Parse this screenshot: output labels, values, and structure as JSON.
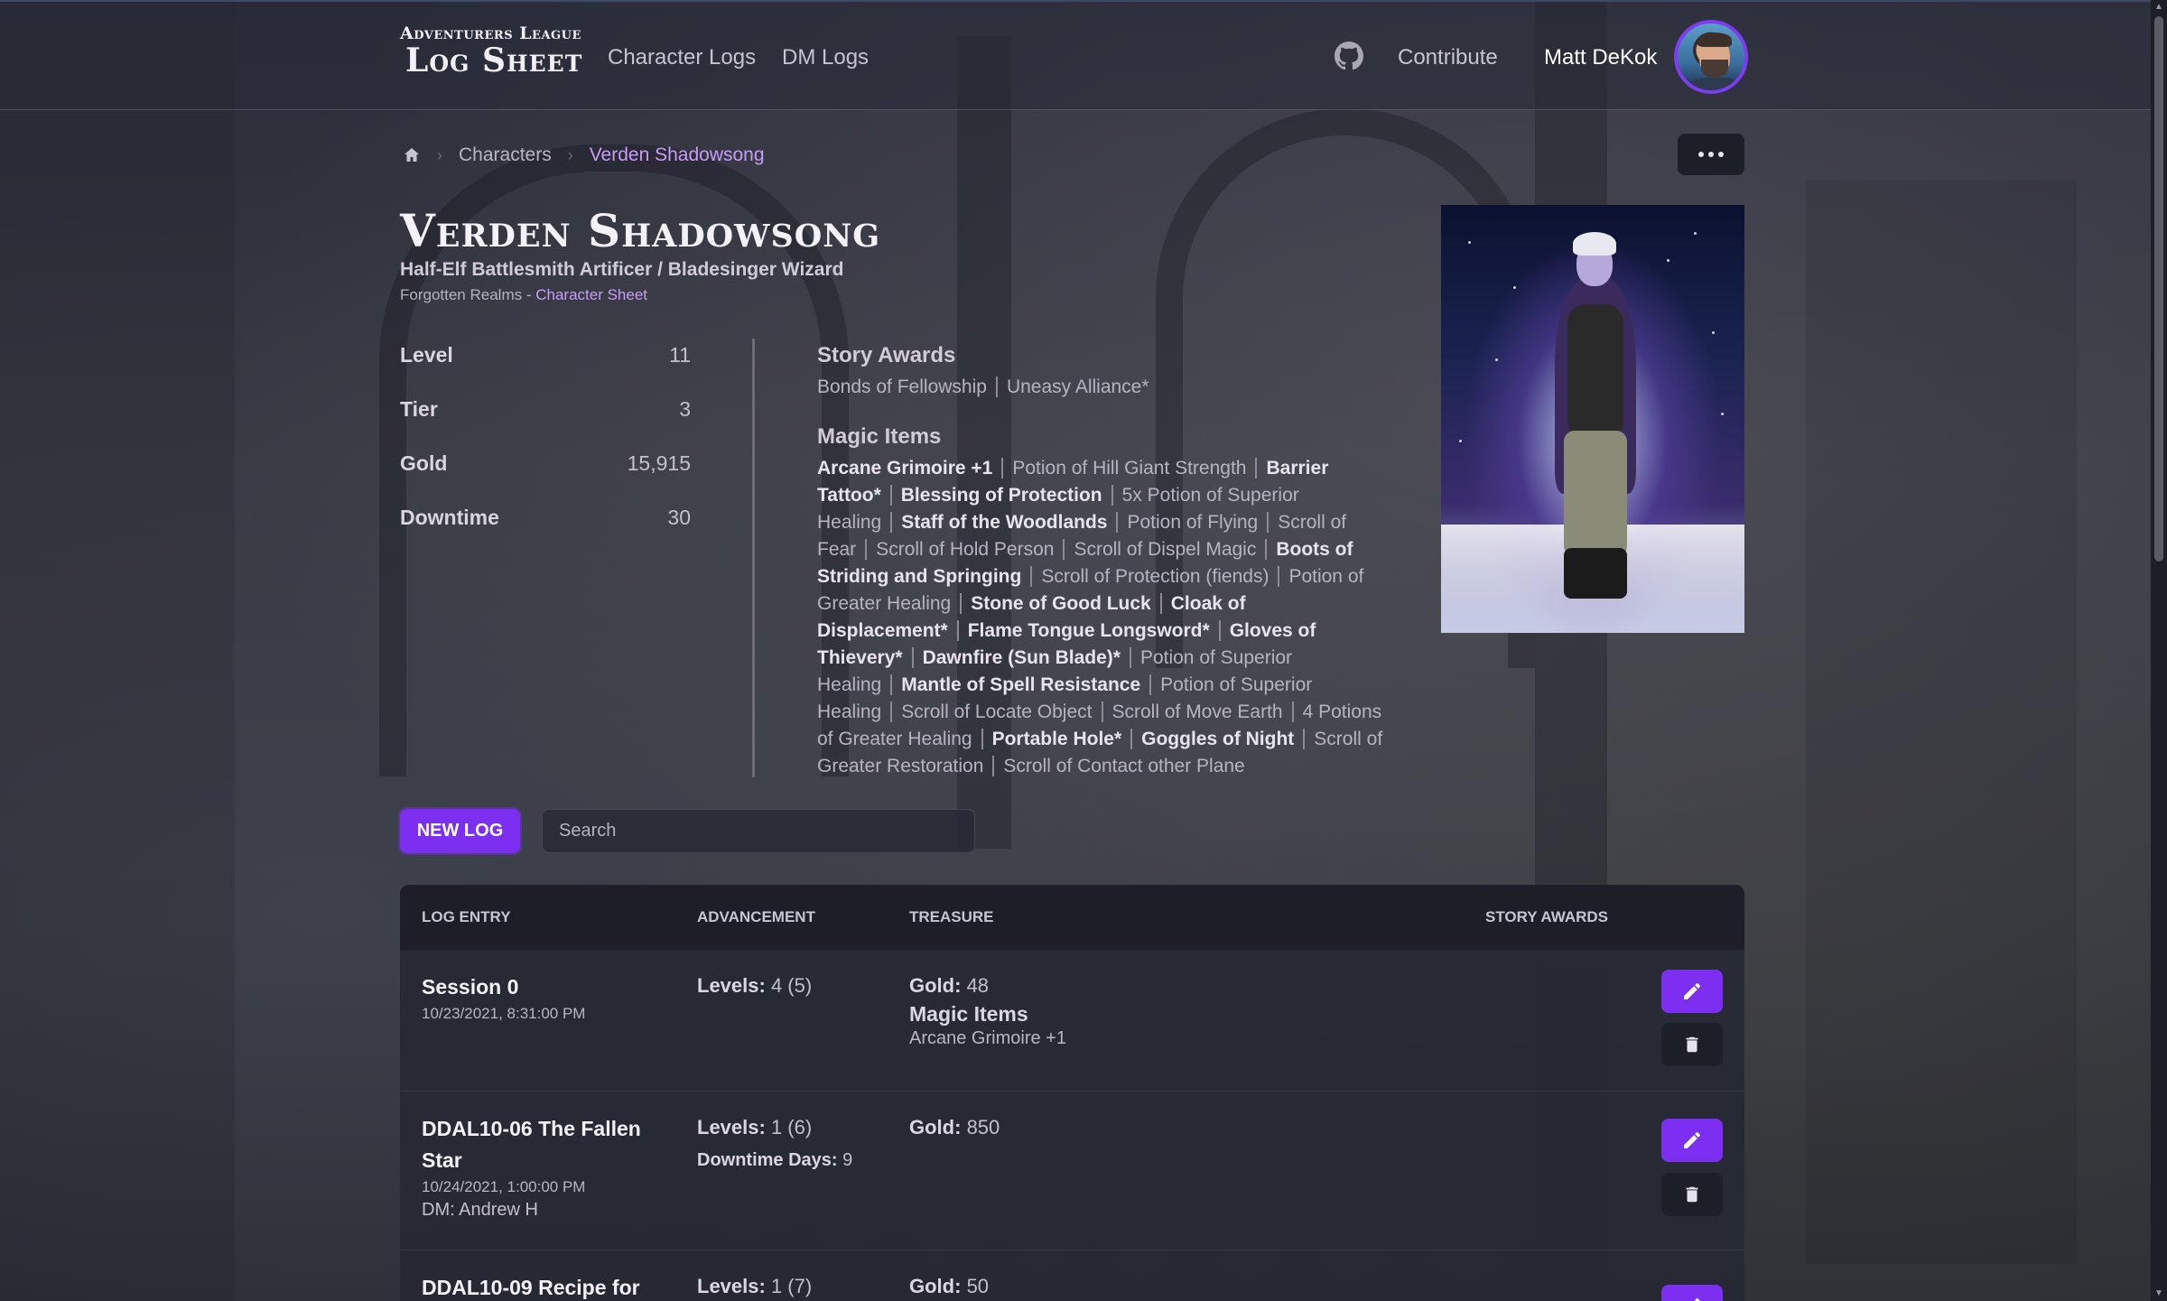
{
  "header": {
    "logo_small": "Adventurers League",
    "logo_big": "Log Sheet",
    "nav": [
      "Character Logs",
      "DM Logs"
    ],
    "contribute": "Contribute",
    "user_name": "Matt DeKok"
  },
  "breadcrumb": {
    "items": [
      "Characters",
      "Verden Shadowsong"
    ]
  },
  "character": {
    "name": "Verden Shadowsong",
    "class_line": "Half-Elf Battlesmith Artificer / Bladesinger Wizard",
    "campaign": "Forgotten Realms - ",
    "sheet_link": "Character Sheet"
  },
  "stats": [
    {
      "label": "Level",
      "value": "11"
    },
    {
      "label": "Tier",
      "value": "3"
    },
    {
      "label": "Gold",
      "value": "15,915"
    },
    {
      "label": "Downtime",
      "value": "30"
    }
  ],
  "story_awards": {
    "title": "Story Awards",
    "items": [
      "Bonds of Fellowship",
      "Uneasy Alliance*"
    ]
  },
  "magic_items": {
    "title": "Magic Items",
    "items": [
      {
        "name": "Arcane Grimoire +1",
        "bold": true
      },
      {
        "name": "Potion of Hill Giant Strength",
        "bold": false
      },
      {
        "name": "Barrier Tattoo*",
        "bold": true
      },
      {
        "name": "Blessing of Protection",
        "bold": true
      },
      {
        "name": "5x Potion of Superior Healing",
        "bold": false
      },
      {
        "name": "Staff of the Woodlands",
        "bold": true
      },
      {
        "name": "Potion of Flying",
        "bold": false
      },
      {
        "name": "Scroll of Fear",
        "bold": false
      },
      {
        "name": "Scroll of Hold Person",
        "bold": false
      },
      {
        "name": "Scroll of Dispel Magic",
        "bold": false
      },
      {
        "name": "Boots of Striding and Springing",
        "bold": true
      },
      {
        "name": "Scroll of Protection (fiends)",
        "bold": false
      },
      {
        "name": "Potion of Greater Healing",
        "bold": false
      },
      {
        "name": "Stone of Good Luck",
        "bold": true
      },
      {
        "name": "Cloak of Displacement*",
        "bold": true
      },
      {
        "name": "Flame Tongue Longsword*",
        "bold": true
      },
      {
        "name": "Gloves of Thievery*",
        "bold": true
      },
      {
        "name": "Dawnfire (Sun Blade)*",
        "bold": true
      },
      {
        "name": "Potion of Superior Healing",
        "bold": false
      },
      {
        "name": "Mantle of Spell Resistance",
        "bold": true
      },
      {
        "name": "Potion of Superior Healing",
        "bold": false
      },
      {
        "name": "Scroll of Locate Object",
        "bold": false
      },
      {
        "name": "Scroll of Move Earth",
        "bold": false
      },
      {
        "name": "4 Potions of Greater Healing",
        "bold": false
      },
      {
        "name": "Portable Hole*",
        "bold": true
      },
      {
        "name": "Goggles of Night",
        "bold": true
      },
      {
        "name": "Scroll of Greater Restoration",
        "bold": false
      },
      {
        "name": "Scroll of Contact other Plane",
        "bold": false
      }
    ]
  },
  "actions": {
    "new_log": "NEW LOG",
    "search_placeholder": "Search"
  },
  "table": {
    "headers": [
      "Log Entry",
      "Advancement",
      "Treasure",
      "Story Awards"
    ],
    "rows": [
      {
        "title": "Session 0",
        "date": "10/23/2021, 8:31:00 PM",
        "dm": "",
        "levels_label": "Levels:",
        "levels": "4 (5)",
        "downtime_label": "",
        "downtime": "",
        "gold_label": "Gold:",
        "gold": "48",
        "magic_items_label": "Magic Items",
        "magic_items": "Arcane Grimoire +1"
      },
      {
        "title": "DDAL10-06 The Fallen Star",
        "date": "10/24/2021, 1:00:00 PM",
        "dm": "DM: Andrew H",
        "levels_label": "Levels:",
        "levels": "1 (6)",
        "downtime_label": "Downtime Days:",
        "downtime": "9",
        "gold_label": "Gold:",
        "gold": "850",
        "magic_items_label": "",
        "magic_items": ""
      },
      {
        "title": "DDAL10-09 Recipe for",
        "date": "",
        "dm": "",
        "levels_label": "Levels:",
        "levels": "1 (7)",
        "downtime_label": "",
        "downtime": "",
        "gold_label": "Gold:",
        "gold": "50",
        "magic_items_label": "",
        "magic_items": ""
      }
    ]
  },
  "colors": {
    "accent": "#7c2ff0",
    "link": "#c89cf7"
  },
  "icons": [
    "github-icon",
    "home-icon",
    "more-icon",
    "edit-icon",
    "delete-icon"
  ]
}
